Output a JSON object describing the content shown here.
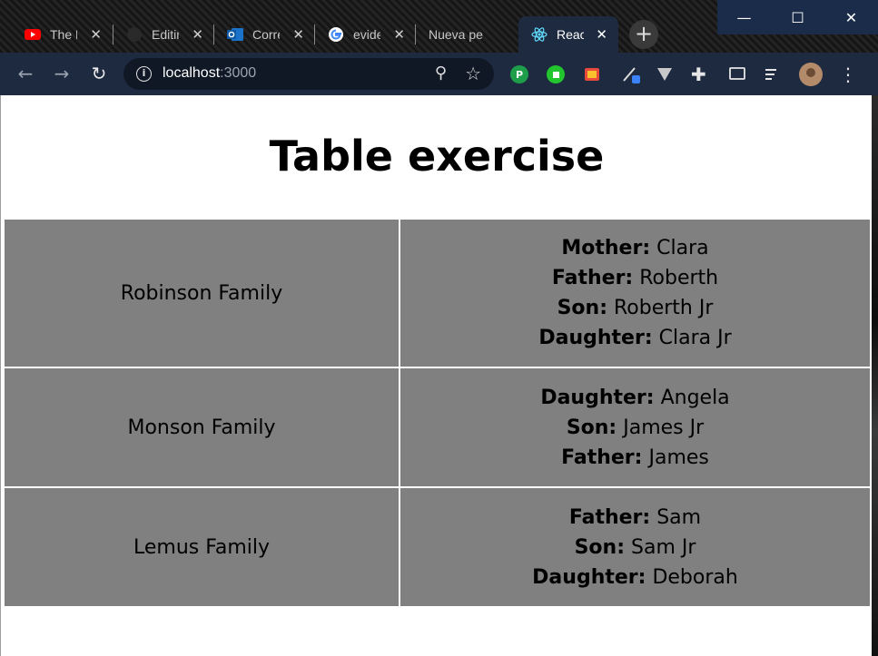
{
  "browser": {
    "tabs": [
      {
        "title": "The M",
        "icon": "youtube-icon"
      },
      {
        "title": "Editin",
        "icon": "github-icon"
      },
      {
        "title": "Corre",
        "icon": "outlook-icon"
      },
      {
        "title": "evide",
        "icon": "google-icon"
      },
      {
        "title": "Nueva pe",
        "icon": "none"
      },
      {
        "title": "React",
        "icon": "react-icon",
        "active": true
      }
    ],
    "new_tab": "+",
    "url_host": "localhost",
    "url_port": ":3000",
    "window_controls": [
      "—",
      "☐",
      "✕"
    ]
  },
  "page": {
    "title": "Table exercise",
    "families": [
      {
        "name": "Robinson Family",
        "members": [
          {
            "role": "Mother:",
            "name": "Clara"
          },
          {
            "role": "Father:",
            "name": "Roberth"
          },
          {
            "role": "Son:",
            "name": "Roberth Jr"
          },
          {
            "role": "Daughter:",
            "name": "Clara Jr"
          }
        ]
      },
      {
        "name": "Monson Family",
        "members": [
          {
            "role": "Daughter:",
            "name": "Angela"
          },
          {
            "role": "Son:",
            "name": "James Jr"
          },
          {
            "role": "Father:",
            "name": "James"
          }
        ]
      },
      {
        "name": "Lemus Family",
        "members": [
          {
            "role": "Father:",
            "name": "Sam"
          },
          {
            "role": "Son:",
            "name": "Sam Jr"
          },
          {
            "role": "Daughter:",
            "name": "Deborah"
          }
        ]
      }
    ]
  },
  "colors": {
    "cell_bg": "#808080",
    "toolbar_bg": "#1d2a40"
  }
}
